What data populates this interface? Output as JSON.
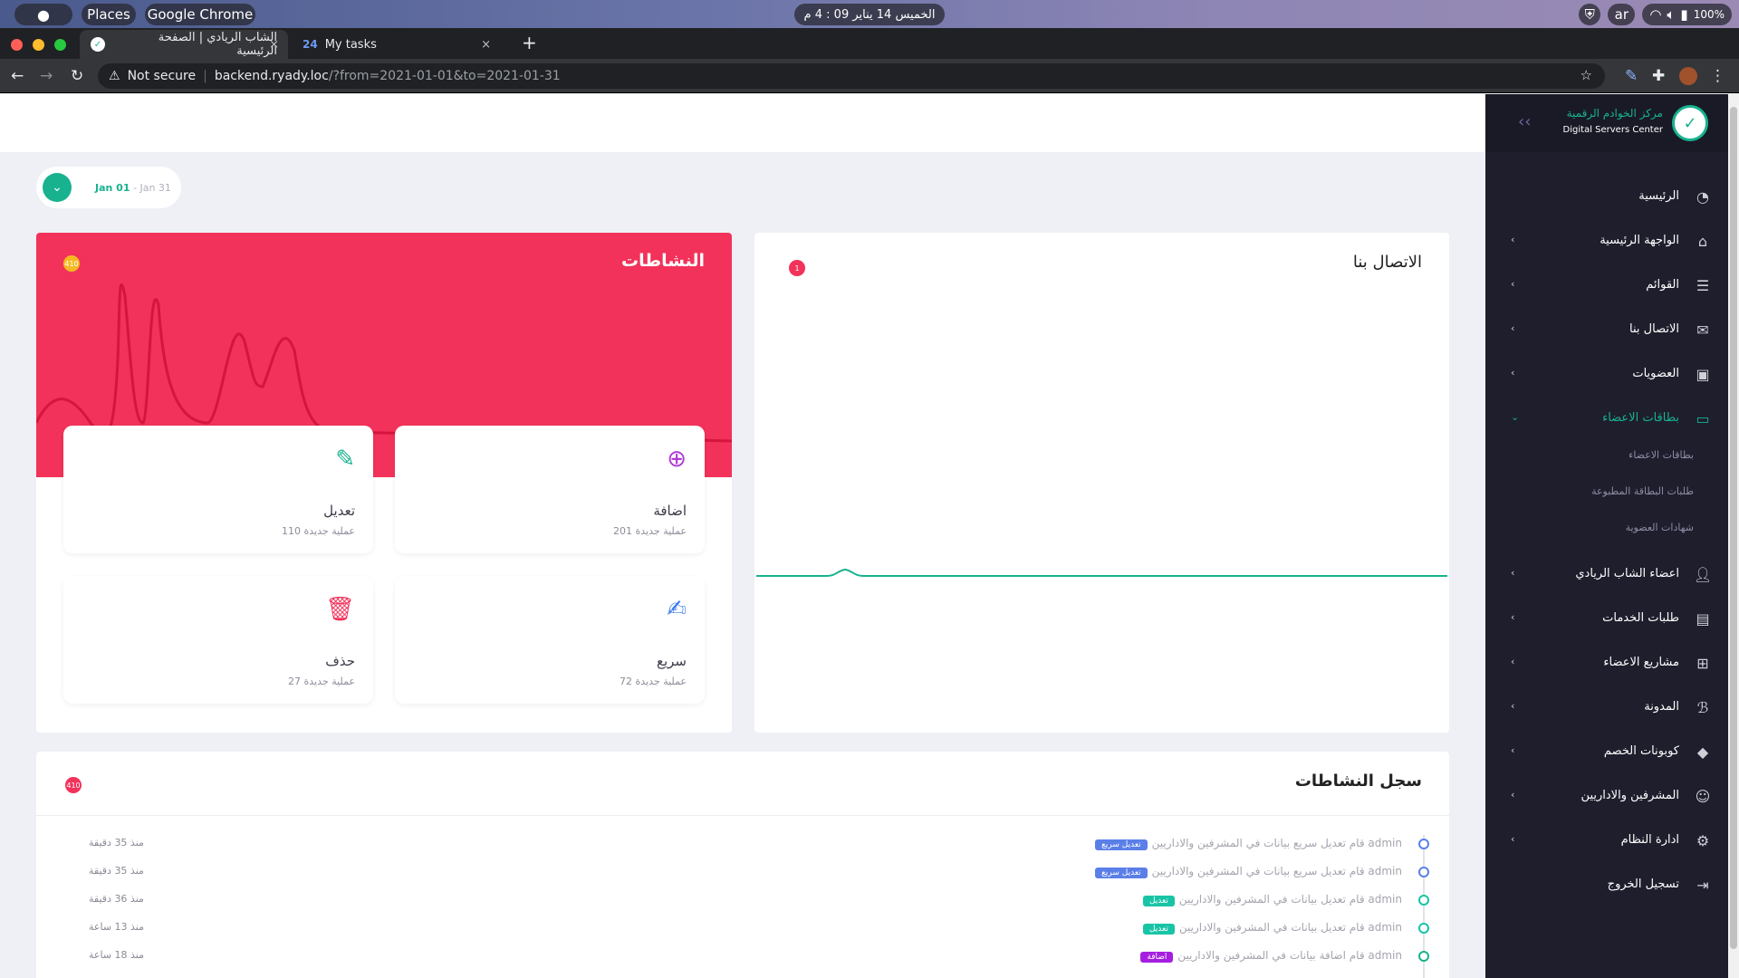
{
  "system": {
    "apple": "",
    "places": "Places",
    "app": "Google Chrome",
    "clock": "الخميس 14 يناير  09 : 4 م",
    "lang": "ar",
    "battery": "100%"
  },
  "browser": {
    "tabs": [
      {
        "title": "الشاب الريادي | الصفحة الرئيسية",
        "close": "×"
      },
      {
        "title": "My tasks",
        "close": "×"
      }
    ],
    "new_tab": "+",
    "security": "Not secure",
    "url_host": "backend.ryady.loc",
    "url_path": "/?from=2021-01-01&to=2021-01-31"
  },
  "date_range": {
    "from": "Jan 01",
    "separator": " - ",
    "to": "Jan 31"
  },
  "activities": {
    "title": "النشاطات",
    "badge": "410",
    "chart_color": "#d6153f",
    "cards": [
      {
        "label": "اضافة",
        "count": "201 عملية جديدة",
        "icon": "plus-circle-icon",
        "color": "#b03ad8"
      },
      {
        "label": "تعديل",
        "count": "110 عملية جديدة",
        "icon": "pencil-icon",
        "color": "#18b28f"
      },
      {
        "label": "سريع",
        "count": "72 عملية جديدة",
        "icon": "edit-note-icon",
        "color": "#3e7bea"
      },
      {
        "label": "حذف",
        "count": "27 عملية جديدة",
        "icon": "trash-icon",
        "color": "#f2325a"
      }
    ]
  },
  "contact": {
    "title": "الاتصال بنا",
    "badge": "1",
    "line_color": "#18b28f"
  },
  "log": {
    "title": "سجل النشاطات",
    "badge": "410",
    "rows": [
      {
        "text": "admin قام تعديل سريع بيانات في المشرفين والاداريين",
        "tag": "تعديل سريع",
        "tag_color": "#5b7fe8",
        "time": "منذ 35 دقيقة",
        "dot": "#5b7fe8"
      },
      {
        "text": "admin قام تعديل سريع بيانات في المشرفين والاداريين",
        "tag": "تعديل سريع",
        "tag_color": "#5b7fe8",
        "time": "منذ 35 دقيقة",
        "dot": "#5b7fe8"
      },
      {
        "text": "admin قام تعديل بيانات في المشرفين والاداريين",
        "tag": "تعديل",
        "tag_color": "#18c4a5",
        "time": "منذ 36 دقيقة",
        "dot": "#18c4a5"
      },
      {
        "text": "admin قام تعديل بيانات في المشرفين والاداريين",
        "tag": "تعديل",
        "tag_color": "#18c4a5",
        "time": "منذ 13 ساعة",
        "dot": "#18c4a5"
      },
      {
        "text": "admin قام اضافة بيانات في المشرفين والاداريين",
        "tag": "اضافة",
        "tag_color": "#a51ee0",
        "time": "منذ 18 ساعة",
        "dot": "#18b28f"
      }
    ]
  },
  "sidebar": {
    "brand_ar": "مركز الخوادم الرقمية",
    "brand_en": "Digital Servers Center",
    "items": [
      {
        "label": "الرئيسية",
        "icon": "dashboard-gauge-icon",
        "arrow": false
      },
      {
        "label": "الواجهة الرئيسية",
        "icon": "home-icon",
        "arrow": true
      },
      {
        "label": "القوائم",
        "icon": "list-icon",
        "arrow": true
      },
      {
        "label": "الاتصال بنا",
        "icon": "mail-icon",
        "arrow": true
      },
      {
        "label": "العضويات",
        "icon": "id-card-icon",
        "arrow": true
      },
      {
        "label": "بطاقات الاعضاء",
        "icon": "credit-card-icon",
        "arrow": true,
        "active": true
      },
      {
        "label": "اعضاء الشاب الريادي",
        "icon": "user-icon",
        "arrow": true
      },
      {
        "label": "طلبات الخدمات",
        "icon": "message-icon",
        "arrow": true
      },
      {
        "label": "مشاريع الاعضاء",
        "icon": "sitemap-icon",
        "arrow": true
      },
      {
        "label": "المدونة",
        "icon": "blog-icon",
        "arrow": true
      },
      {
        "label": "كوبونات الخصم",
        "icon": "tag-icon",
        "arrow": true
      },
      {
        "label": "المشرفين والاداريين",
        "icon": "admin-user-icon",
        "arrow": true
      },
      {
        "label": "ادارة النظام",
        "icon": "gear-icon",
        "arrow": true
      },
      {
        "label": "تسجيل الخروج",
        "icon": "logout-icon",
        "arrow": false
      }
    ],
    "sub_items": [
      "بطاقات الاعضاء",
      "طلبات البطاقة المطبوعة",
      "شهادات العضوية"
    ],
    "accent": "#18b28f"
  }
}
